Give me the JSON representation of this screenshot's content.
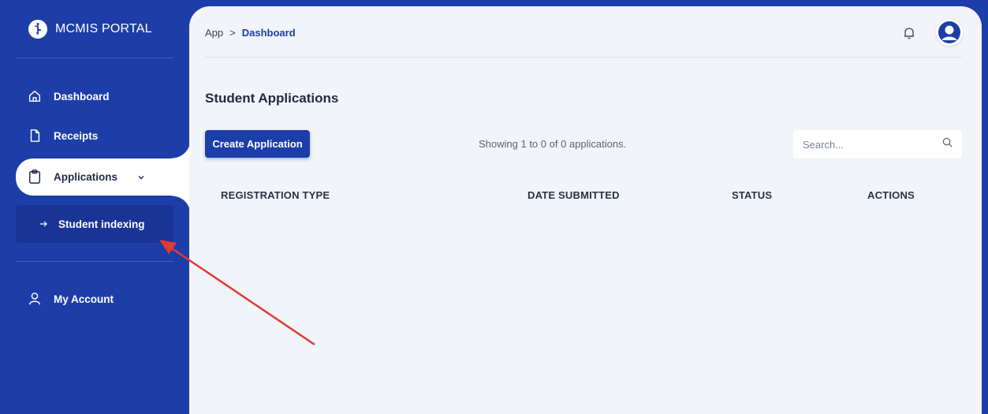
{
  "brand": {
    "title": "MCMIS PORTAL"
  },
  "sidebar": {
    "items": [
      {
        "label": "Dashboard",
        "icon": "home-icon"
      },
      {
        "label": "Receipts",
        "icon": "file-icon"
      },
      {
        "label": "Applications",
        "icon": "clipboard-icon",
        "active": true,
        "expanded": true
      },
      {
        "label": "My Account",
        "icon": "user-icon"
      }
    ],
    "subitems": [
      {
        "label": "Student indexing",
        "icon": "arrow-right-icon"
      }
    ]
  },
  "breadcrumb": {
    "root": "App",
    "separator": ">",
    "current": "Dashboard"
  },
  "main": {
    "title": "Student Applications",
    "create_button": "Create Application",
    "showing_text": "Showing 1 to 0 of 0 applications.",
    "search_placeholder": "Search...",
    "table": {
      "columns": [
        "REGISTRATION TYPE",
        "DATE SUBMITTED",
        "STATUS",
        "ACTIONS"
      ],
      "rows": []
    }
  },
  "colors": {
    "primary": "#1d3ea8",
    "content_bg": "#f1f4f9",
    "annotation_arrow": "#e53935"
  }
}
